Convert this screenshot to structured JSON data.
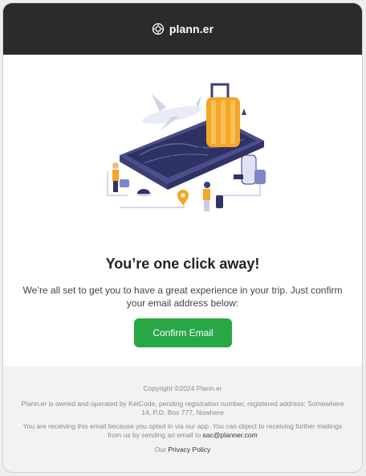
{
  "header": {
    "brand": "plann.er",
    "logo_icon": "compass-icon",
    "background": "#2b2b2b"
  },
  "hero": {
    "title": "You’re one click away!",
    "description": "We’re all set to get you to have a great experience in your trip. Just confirm your email address below:",
    "button_label": "Confirm Email",
    "button_color": "#28a745",
    "illustration_icon": "travel-phone-illustration"
  },
  "footer": {
    "copyright": "Copyright ©2024 Plann.er",
    "legal": "Plann.er is owned and operated by KetCode, pending registration number, registered address: Somewhere 14, P.O. Box 777, Nowhere",
    "notice_prefix": "You are receiving this email because you opted in via our app. You can object to receiving further mailings from us by sending an email to",
    "notice_email": "sac@planner.com",
    "policy_prefix": "Our",
    "policy_link": "Privacy Policy"
  }
}
